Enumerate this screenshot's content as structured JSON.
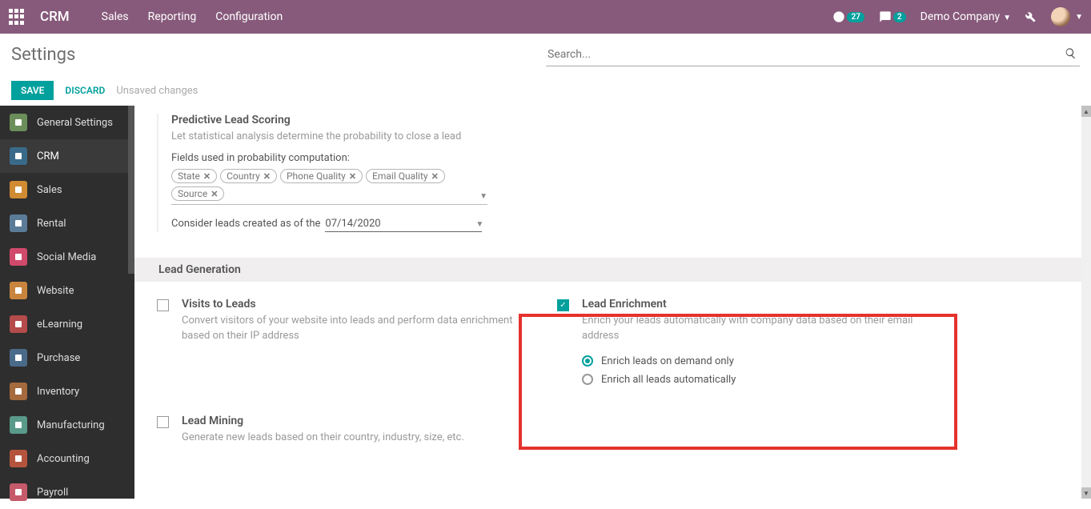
{
  "topbar": {
    "brand": "CRM",
    "nav": [
      "Sales",
      "Reporting",
      "Configuration"
    ],
    "clock_badge": "27",
    "chat_badge": "2",
    "company": "Demo Company"
  },
  "subheader": {
    "title": "Settings",
    "search_placeholder": "Search..."
  },
  "actions": {
    "save": "SAVE",
    "discard": "DISCARD",
    "status": "Unsaved changes"
  },
  "sidebar": [
    {
      "label": "General Settings",
      "color": "#6B8E5A"
    },
    {
      "label": "CRM",
      "color": "#3A6A8A",
      "active": true
    },
    {
      "label": "Sales",
      "color": "#D08B33"
    },
    {
      "label": "Rental",
      "color": "#5B7C99"
    },
    {
      "label": "Social Media",
      "color": "#D04A6B"
    },
    {
      "label": "Website",
      "color": "#C9853D"
    },
    {
      "label": "eLearning",
      "color": "#B54B4B"
    },
    {
      "label": "Purchase",
      "color": "#4A6A8A"
    },
    {
      "label": "Inventory",
      "color": "#A56A3D"
    },
    {
      "label": "Manufacturing",
      "color": "#5A9A8A"
    },
    {
      "label": "Accounting",
      "color": "#B5543D"
    },
    {
      "label": "Payroll",
      "color": "#C55A6A"
    }
  ],
  "pls": {
    "title": "Predictive Lead Scoring",
    "desc": "Let statistical analysis determine the probability to close a lead",
    "fields_label": "Fields used in probability computation:",
    "tags": [
      "State",
      "Country",
      "Phone Quality",
      "Email Quality",
      "Source"
    ],
    "date_label": "Consider leads created as of the",
    "date_value": "07/14/2020"
  },
  "leadgen": {
    "header": "Lead Generation",
    "visits": {
      "title": "Visits to Leads",
      "desc": "Convert visitors of your website into leads and perform data enrichment based on their IP address"
    },
    "enrich": {
      "title": "Lead Enrichment",
      "desc": "Enrich your leads automatically with company data based on their email address",
      "opt1": "Enrich leads on demand only",
      "opt2": "Enrich all leads automatically"
    },
    "mining": {
      "title": "Lead Mining",
      "desc": "Generate new leads based on their country, industry, size, etc."
    }
  }
}
